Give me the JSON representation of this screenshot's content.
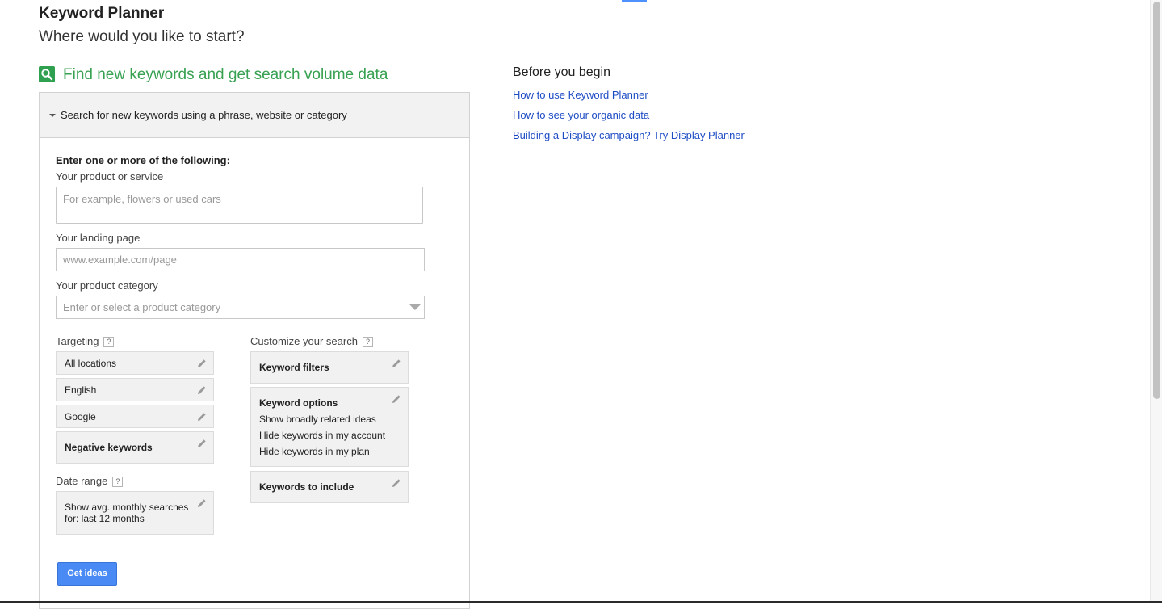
{
  "header": {
    "title": "Keyword Planner",
    "subtitle": "Where would you like to start?"
  },
  "find_section": {
    "icon": "search-icon",
    "title": "Find new keywords and get search volume data",
    "accent_color": "#38a152"
  },
  "panel": {
    "header_label": "Search for new keywords using a phrase, website or category",
    "intro": "Enter one or more of the following:",
    "product_label": "Your product or service",
    "product_placeholder": "For example, flowers or used cars",
    "landing_label": "Your landing page",
    "landing_placeholder": "www.example.com/page",
    "category_label": "Your product category",
    "category_placeholder": "Enter or select a product category",
    "targeting": {
      "label": "Targeting",
      "help": "?",
      "items": [
        "All locations",
        "English",
        "Google"
      ],
      "negative": "Negative keywords"
    },
    "date_range": {
      "label": "Date range",
      "help": "?",
      "value": "Show avg. monthly searches for: last 12 months"
    },
    "customize": {
      "label": "Customize your search",
      "help": "?",
      "keyword_filters": "Keyword filters",
      "keyword_options": {
        "title": "Keyword options",
        "lines": [
          "Show broadly related ideas",
          "Hide keywords in my account",
          "Hide keywords in my plan"
        ]
      },
      "keywords_to_include": "Keywords to include"
    },
    "get_ideas_button": "Get ideas",
    "button_color": "#4a8af4"
  },
  "sidebar": {
    "title": "Before you begin",
    "links": [
      "How to use Keyword Planner",
      "How to see your organic data",
      "Building a Display campaign? Try Display Planner"
    ],
    "link_color": "#1e4cc4"
  }
}
